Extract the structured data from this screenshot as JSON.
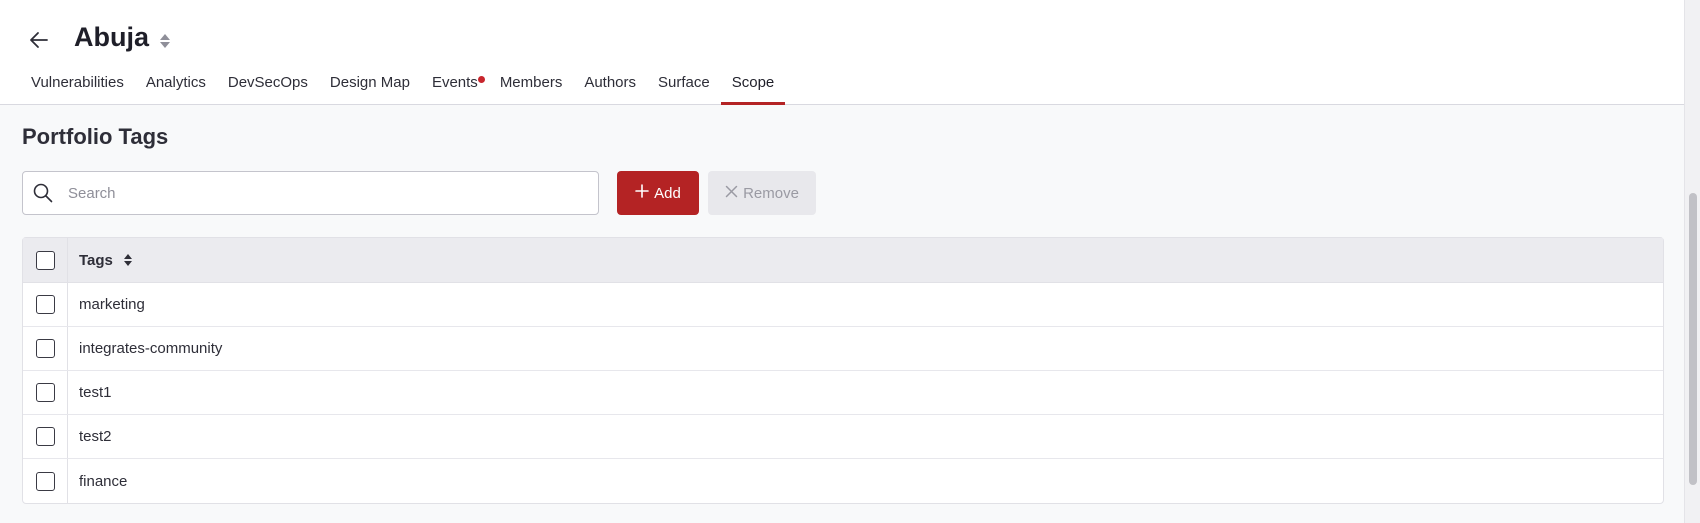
{
  "header": {
    "title": "Abuja"
  },
  "tabs": [
    {
      "label": "Vulnerabilities",
      "active": false,
      "badge": false
    },
    {
      "label": "Analytics",
      "active": false,
      "badge": false
    },
    {
      "label": "DevSecOps",
      "active": false,
      "badge": false
    },
    {
      "label": "Design Map",
      "active": false,
      "badge": false
    },
    {
      "label": "Events",
      "active": false,
      "badge": true
    },
    {
      "label": "Members",
      "active": false,
      "badge": false
    },
    {
      "label": "Authors",
      "active": false,
      "badge": false
    },
    {
      "label": "Surface",
      "active": false,
      "badge": false
    },
    {
      "label": "Scope",
      "active": true,
      "badge": false
    }
  ],
  "section": {
    "title": "Portfolio Tags"
  },
  "search": {
    "placeholder": "Search",
    "value": ""
  },
  "actions": {
    "add_label": "Add",
    "remove_label": "Remove"
  },
  "table": {
    "column_header": "Tags",
    "rows": [
      "marketing",
      "integrates-community",
      "test1",
      "test2",
      "finance"
    ]
  },
  "colors": {
    "accent": "#b42324",
    "badge": "#c8252c",
    "disabled_button_bg": "#e8e8ec"
  }
}
